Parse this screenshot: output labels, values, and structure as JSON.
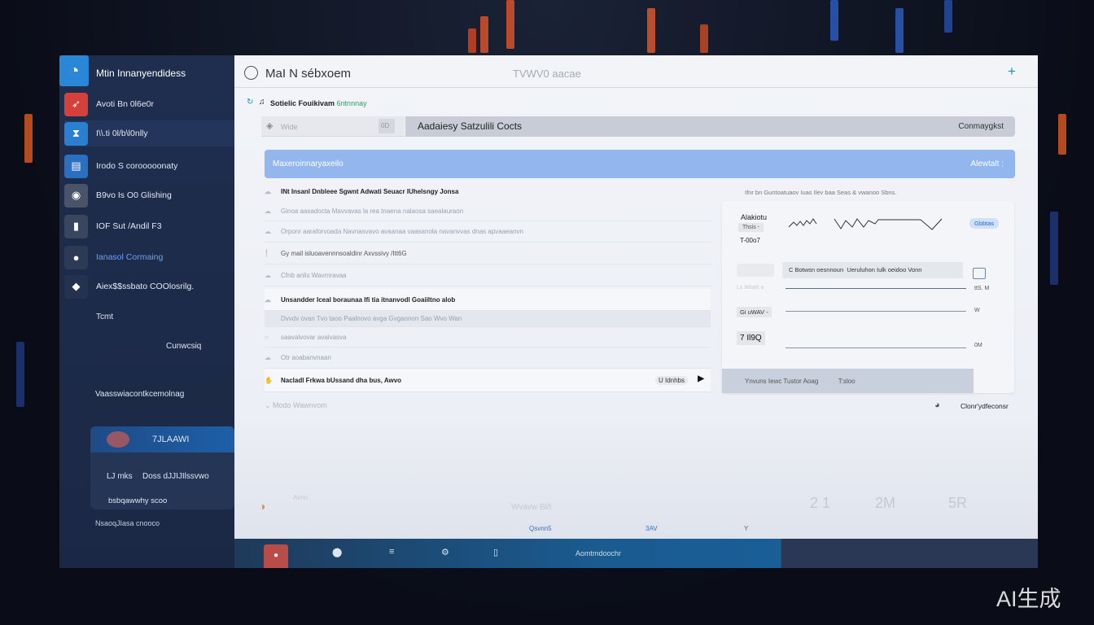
{
  "sidebar": {
    "app_title": "Mtin Innanyendidess",
    "items": [
      {
        "label": "Avoti Bn 0l6e0r",
        "icon": "cart-icon",
        "color": "#d6403a"
      },
      {
        "label": "I\\\\.ti 0l/b\\l0nlly",
        "icon": "hourglass-icon",
        "color": "#2a7fd0"
      },
      {
        "label": "Irodo S corooooonaty",
        "icon": "document-icon",
        "color": "#2a6fc0"
      },
      {
        "label": "B9vo Is O0 Glishing",
        "icon": "person-icon",
        "color": "#4a5368"
      },
      {
        "label": "IOF Sut /Andil F3",
        "icon": "door-icon",
        "color": "#3a4560"
      },
      {
        "label": "Ianasol Cormaing",
        "icon": "bulb-icon",
        "color": "#2d3a55",
        "active": true
      },
      {
        "label": "Aiex$$ssbato COOlosrilg.",
        "icon": "chat-icon",
        "color": "#243250"
      }
    ],
    "extra_label": "Tcmt",
    "section_label": "Cunwcsiq",
    "search_label": "Vaasswiacontkcemolnag",
    "card": {
      "title": "7JLAAWI",
      "row_left": "LJ mks",
      "row_right": "Doss dJJIJIlssvwo",
      "subtitle": "bsbqawwhy scoo"
    },
    "footer": "NsaoqJIasa cnooco"
  },
  "main": {
    "title": "MaI N sébxoem",
    "center_title": "TVWV0 aacae",
    "add_icon": "plus-icon",
    "breadcrumb_prefix": "Sotielic Fouikivam",
    "breadcrumb_tag": "6ntnnnay",
    "search_placeholder": "Wide",
    "search_badge": "0D",
    "header_bar_label": "Aadaiesy Satzulili Cocts",
    "header_bar_action": "Conmaygkst",
    "banner_label": "Maxeroinnaryaxeilo",
    "banner_action": "Alewtalt :",
    "rows": [
      {
        "text": "INt Insanl Dnbleee Sgwnt Adwati Seuacr IUhelsngy Jonsa",
        "bold": true
      },
      {
        "text": "Ginoa aasadocta Mavvavas la rea tnaena nalaosa saealauraon",
        "bold": false
      },
      {
        "text": "Orponr aaraforvoada Navnasvavo avaanaa vaasanola navanvvas dnas apvaaeanvn",
        "bold": false
      },
      {
        "text": "Gy mail isluoavennnsoaldinr Axvssivy /Itt6G",
        "bold": false
      },
      {
        "text": "Cfnb anlis Wavrnravaa",
        "bold": false
      },
      {
        "text": "Unsandder Iceal boraunaa Ifi tia itnanvodl Goaiiltno alob",
        "bold": true
      },
      {
        "text": "Dvvdv ovan Tvo taoo Paalnovo avga Gvgaonon Sao Wvo Wan",
        "bold": false
      },
      {
        "text": "saavalvovar avaivasva",
        "bold": false
      },
      {
        "text": "Otr aoabanvnaan",
        "bold": false
      },
      {
        "text": "Nacladl Frkwa bUssand dha bus, Awvo",
        "bold": true,
        "action": "U Idnhbs"
      }
    ],
    "more_label": "Modo Wawnvom",
    "panel": {
      "caption": "Ifnr bn Guntoatuaov Iuas Ilev baa Seas & vwanoo Sbns.",
      "metric_label": "Alakiotu",
      "metric_pill": "Thsis -",
      "metric_value": "T-00o7",
      "sparkline_badge": "Gbbtas",
      "filter_text": "C Botwsn oesnnoun",
      "filter_text2": "Ueruluhon Iulk oeidoo Vonn",
      "rows": [
        {
          "label": "Ls Ieliatit o",
          "value": "ttS. M"
        },
        {
          "label": "Gi uWAV -",
          "value": "W"
        },
        {
          "label": "7 Il9Q",
          "value": "0M"
        }
      ],
      "footer_left": "Ynvuns Iewc Tustor Aoag",
      "footer_right": "T:sloo",
      "link_label": "Clonr'ydfeconsr"
    },
    "faded_row": {
      "a": "Avnn",
      "b": "Wvavw Bl/t",
      "c": "2 1",
      "d": "2M",
      "e": "5R"
    },
    "status": {
      "a": "Qsvnn5",
      "b": "3AV",
      "c": "Y"
    }
  },
  "bottombar": {
    "label": "Aomtmdoochr",
    "icons": [
      "record-icon",
      "location-icon",
      "list-icon",
      "settings-icon",
      "window-icon"
    ]
  },
  "watermark": "AI生成"
}
